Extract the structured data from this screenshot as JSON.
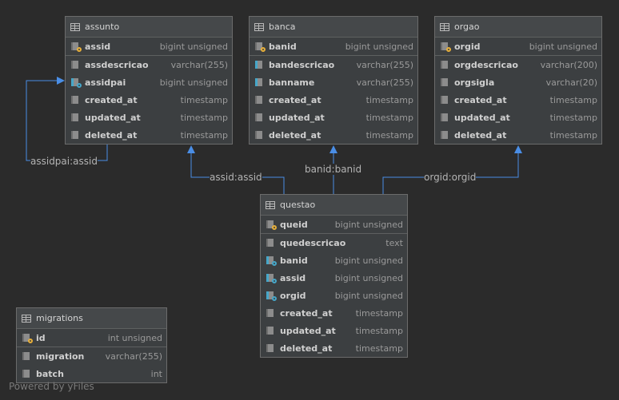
{
  "tables": {
    "assunto": {
      "name": "assunto",
      "pk": {
        "name": "assid",
        "type": "bigint unsigned",
        "icon": "primary-key-icon"
      },
      "columns": [
        {
          "name": "assdescricao",
          "type": "varchar(255)",
          "icon": "column-icon"
        },
        {
          "name": "assidpai",
          "type": "bigint unsigned",
          "icon": "foreign-key-icon"
        },
        {
          "name": "created_at",
          "type": "timestamp",
          "icon": "column-icon"
        },
        {
          "name": "updated_at",
          "type": "timestamp",
          "icon": "column-icon"
        },
        {
          "name": "deleted_at",
          "type": "timestamp",
          "icon": "column-icon"
        }
      ]
    },
    "banca": {
      "name": "banca",
      "pk": {
        "name": "banid",
        "type": "bigint unsigned",
        "icon": "primary-key-icon"
      },
      "columns": [
        {
          "name": "bandescricao",
          "type": "varchar(255)",
          "icon": "indexed-column-icon"
        },
        {
          "name": "banname",
          "type": "varchar(255)",
          "icon": "indexed-column-icon"
        },
        {
          "name": "created_at",
          "type": "timestamp",
          "icon": "column-icon"
        },
        {
          "name": "updated_at",
          "type": "timestamp",
          "icon": "column-icon"
        },
        {
          "name": "deleted_at",
          "type": "timestamp",
          "icon": "column-icon"
        }
      ]
    },
    "orgao": {
      "name": "orgao",
      "pk": {
        "name": "orgid",
        "type": "bigint unsigned",
        "icon": "primary-key-icon"
      },
      "columns": [
        {
          "name": "orgdescricao",
          "type": "varchar(200)",
          "icon": "column-icon"
        },
        {
          "name": "orgsigla",
          "type": "varchar(20)",
          "icon": "column-icon"
        },
        {
          "name": "created_at",
          "type": "timestamp",
          "icon": "column-icon"
        },
        {
          "name": "updated_at",
          "type": "timestamp",
          "icon": "column-icon"
        },
        {
          "name": "deleted_at",
          "type": "timestamp",
          "icon": "column-icon"
        }
      ]
    },
    "questao": {
      "name": "questao",
      "pk": {
        "name": "queid",
        "type": "bigint unsigned",
        "icon": "primary-key-icon"
      },
      "columns": [
        {
          "name": "quedescricao",
          "type": "text",
          "icon": "column-icon"
        },
        {
          "name": "banid",
          "type": "bigint unsigned",
          "icon": "foreign-key-icon"
        },
        {
          "name": "assid",
          "type": "bigint unsigned",
          "icon": "foreign-key-icon"
        },
        {
          "name": "orgid",
          "type": "bigint unsigned",
          "icon": "foreign-key-icon"
        },
        {
          "name": "created_at",
          "type": "timestamp",
          "icon": "column-icon"
        },
        {
          "name": "updated_at",
          "type": "timestamp",
          "icon": "column-icon"
        },
        {
          "name": "deleted_at",
          "type": "timestamp",
          "icon": "column-icon"
        }
      ]
    },
    "migrations": {
      "name": "migrations",
      "pk": {
        "name": "id",
        "type": "int unsigned",
        "icon": "primary-key-icon"
      },
      "columns": [
        {
          "name": "migration",
          "type": "varchar(255)",
          "icon": "column-icon"
        },
        {
          "name": "batch",
          "type": "int",
          "icon": "column-icon"
        }
      ]
    }
  },
  "edges": {
    "assunto_self": "assidpai:assid",
    "questao_assunto": "assid:assid",
    "questao_banca": "banid:banid",
    "questao_orgao": "orgid:orgid"
  },
  "colors": {
    "background": "#2b2b2b",
    "edge": "#4a8ee6",
    "header": "#45484a",
    "body": "#3c3f41"
  },
  "watermark": "Powered by yFiles"
}
